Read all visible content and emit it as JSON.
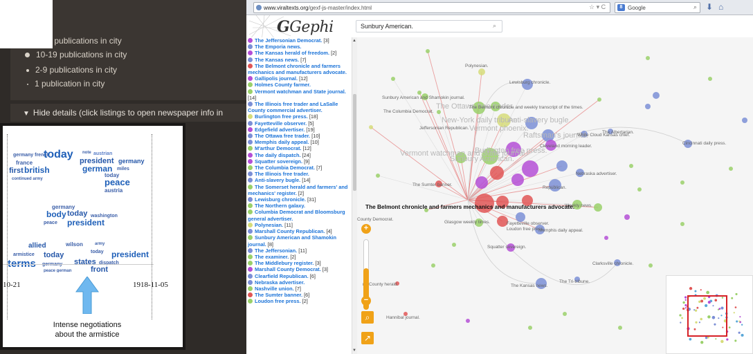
{
  "map_panel": {
    "legend_title": "d",
    "legend_items": [
      {
        "label": "+ publications in city",
        "size": 10
      },
      {
        "label": "10-19 publications in city",
        "size": 7
      },
      {
        "label": "2-9 publications in city",
        "size": 4
      },
      {
        "label": "1 publication in city",
        "size": 2
      }
    ],
    "details_toggle": "Hide details (click listings to open newspaper info in"
  },
  "word_cloud": {
    "date_start": "10-21",
    "date_end": "1918-11-05",
    "caption_line1": "Intense negotiations",
    "caption_line2": "about the armistice"
  },
  "browser": {
    "url_host": "www.viraltexts.org",
    "url_path": "/gexf-js-master/index.html",
    "search_engine": "Google",
    "colors": {
      "accent": "#f0a218",
      "link": "#1b73d8",
      "highlight": "#d62026"
    }
  },
  "gephi": {
    "logo_text": "Gephi",
    "search_value": "Sunbury American.",
    "selected_node": "The Belmont chronicle and farmers mechanics and manufacturers advocate."
  },
  "node_list": [
    {
      "name": "The Jeffersonian Democrat.",
      "count": "[3]",
      "color": "#b44fd6"
    },
    {
      "name": "The Emporia news.",
      "color": "#7b8fd6"
    },
    {
      "name": "The Kansas herald of freedom.",
      "count": "[2]",
      "color": "#b44fd6"
    },
    {
      "name": "The Kansas news.",
      "count": "[7]",
      "color": "#7b8fd6"
    },
    {
      "name": "The Belmont chronicle and farmers mechanics and manufacturers advocate.",
      "color": "#e05656"
    },
    {
      "name": "Gallipolis journal.",
      "count": "[12]",
      "color": "#b44fd6"
    },
    {
      "name": "Holmes County farmer.",
      "color": "#9ad06a"
    },
    {
      "name": "Vermont watchman and State journal.",
      "count": "[14]",
      "color": "#9ad06a"
    },
    {
      "name": "The Illinois free trader and LaSalle County commercial advertiser.",
      "color": "#7b8fd6"
    },
    {
      "name": "Burlington free press.",
      "count": "[18]",
      "color": "#d6dc7a"
    },
    {
      "name": "Fayetteville observer.",
      "count": "[5]",
      "color": "#7b8fd6"
    },
    {
      "name": "Edgefield advertiser.",
      "count": "[19]",
      "color": "#b44fd6"
    },
    {
      "name": "The Ottawa free trader.",
      "count": "[10]",
      "color": "#7b8fd6"
    },
    {
      "name": "Memphis daily appeal.",
      "count": "[10]",
      "color": "#7b8fd6"
    },
    {
      "name": "M'arthur Democrat.",
      "count": "[12]",
      "color": "#9ad06a"
    },
    {
      "name": "The daily dispatch.",
      "count": "[24]",
      "color": "#b44fd6"
    },
    {
      "name": "Squatter sovereign.",
      "count": "[9]",
      "color": "#b44fd6"
    },
    {
      "name": "The Columbia Democrat.",
      "count": "[7]",
      "color": "#9ad06a"
    },
    {
      "name": "The Illinois free trader.",
      "color": "#7b8fd6"
    },
    {
      "name": "Anti-slavery bugle.",
      "count": "[14]",
      "color": "#7b8fd6"
    },
    {
      "name": "The Somerset herald and farmers' and mechanics' register.",
      "count": "[2]",
      "color": "#9ad06a"
    },
    {
      "name": "Lewisburg chronicle.",
      "count": "[31]",
      "color": "#7b8fd6"
    },
    {
      "name": "The Northern galaxy.",
      "color": "#9ad06a"
    },
    {
      "name": "Columbia Democrat and Bloomsburg general advertiser.",
      "color": "#9ad06a"
    },
    {
      "name": "Polynesian.",
      "count": "[11]",
      "color": "#d6dc7a"
    },
    {
      "name": "Marshall County Republican.",
      "count": "[4]",
      "color": "#7b8fd6"
    },
    {
      "name": "Sunbury American and Shamokin journal.",
      "count": "[8]",
      "color": "#9ad06a"
    },
    {
      "name": "The Jeffersonian.",
      "count": "[11]",
      "color": "#7b8fd6"
    },
    {
      "name": "The examiner.",
      "count": "[2]",
      "color": "#9ad06a"
    },
    {
      "name": "The Middlebury register.",
      "count": "[3]",
      "color": "#9ad06a"
    },
    {
      "name": "Marshall County Democrat.",
      "count": "[3]",
      "color": "#b44fd6"
    },
    {
      "name": "Clearfield Republican.",
      "count": "[6]",
      "color": "#7b8fd6"
    },
    {
      "name": "Nebraska advertiser.",
      "color": "#7b8fd6"
    },
    {
      "name": "Nashville union.",
      "count": "[7]",
      "color": "#9ad06a"
    },
    {
      "name": "The Sumter banner.",
      "count": "[6]",
      "color": "#e05656"
    },
    {
      "name": "Loudon free press.",
      "count": "[2]",
      "color": "#9ad06a"
    }
  ],
  "graph_labels": {
    "polynesian": "Polynesian.",
    "lewisburg": "Lewisburg chronicle.",
    "sunbury_shamokin": "Sunbury American and Shamokin journal.",
    "columbia_dem": "The Columbia Democrat.",
    "ottawa": "The Ottawa free trader.",
    "belmont_weekly": "The Belmont chronicle and weekly transcript of the times.",
    "new_york_daily": "New-York daily tribune.",
    "jeffersonian_rep": "Jeffersonian Republican.",
    "vermont_phoenix": "Vermont phoenix.",
    "anti_slavery": "Anti-slavery bugle.",
    "raftsman": "Raftsman's journal.",
    "sunbury_american": "Sunbury American.",
    "white_cloud": "White Cloud Kansas chief.",
    "albertarian": "The Albertarian.",
    "cincinnati": "Cincinnati daily press.",
    "cleveland": "Cleveland morning leader.",
    "vermont_watchman": "Vermont watchman and State journal.",
    "burlington": "Burlington free press.",
    "sumter": "The Sumter banner.",
    "nebraska": "Nebraska advertiser.",
    "republican": "Republican.",
    "weekly_news": "Weekly news.",
    "glasgow": "Glasgow weekly times.",
    "fayetteville": "Fayetteville observer.",
    "loudon": "Loudon free press.",
    "memphis": "Memphis daily appeal.",
    "county_democrat": "County Democrat.",
    "squatter": "Squatter sovereign.",
    "clarksville": "Clarksville chronicle.",
    "county_herald": "nd County herald.",
    "kansas_news": "The Kansas news.",
    "tri_tribune": "The Tri-tribune.",
    "hannibal": "Hannibal journal."
  }
}
